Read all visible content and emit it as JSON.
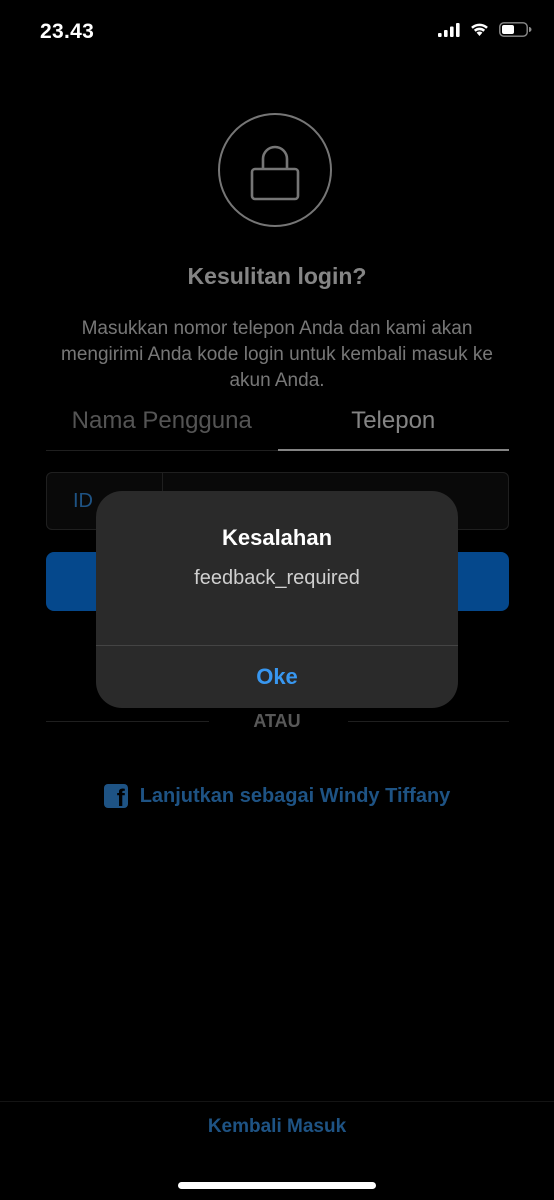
{
  "status_bar": {
    "time": "23.43",
    "icons": [
      "signal-icon",
      "wifi-icon",
      "battery-icon"
    ]
  },
  "screen": {
    "lock_icon": "lock-icon",
    "title": "Kesulitan login?",
    "description": "Masukkan nomor telepon Anda dan kami akan mengirimi Anda kode login untuk kembali masuk ke akun Anda.",
    "tabs": [
      {
        "label": "Nama Pengguna",
        "active": false
      },
      {
        "label": "Telepon",
        "active": true
      }
    ],
    "phone_field": {
      "country_code": "ID",
      "value": "",
      "placeholder": ""
    },
    "divider_text": "ATAU",
    "facebook_continue": {
      "icon": "facebook-icon",
      "label": "Lanjutkan sebagai Windy Tiffany"
    },
    "back_login": "Kembali Masuk"
  },
  "alert": {
    "title": "Kesalahan",
    "message": "feedback_required",
    "ok_label": "Oke"
  },
  "colors": {
    "background": "#000000",
    "accent_blue": "#3897f0",
    "primary_button": "#0a84ff",
    "alert_background": "#2a2a2a"
  }
}
